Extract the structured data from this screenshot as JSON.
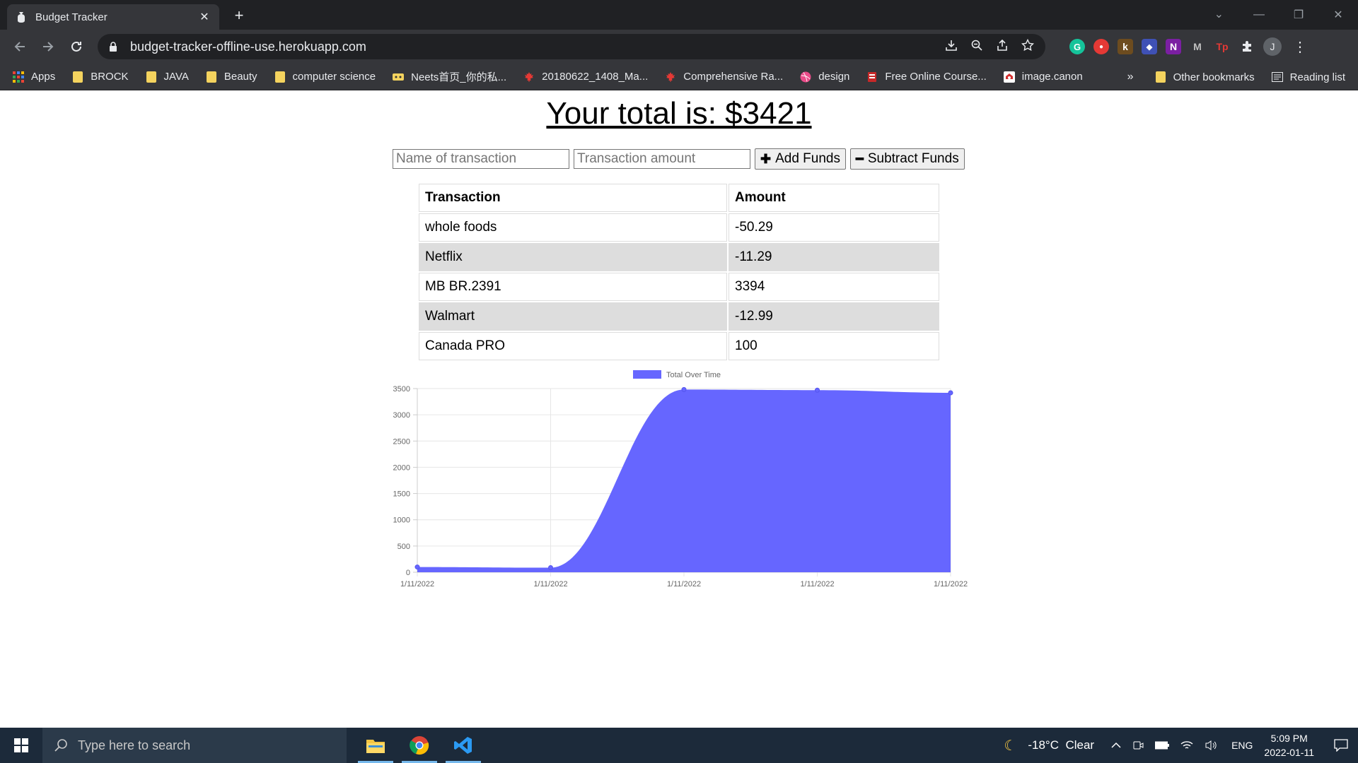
{
  "browser": {
    "tab_title": "Budget Tracker",
    "url": "budget-tracker-offline-use.herokuapp.com",
    "avatar_letter": "J",
    "bookmarks": [
      {
        "label": "Apps",
        "icon": "apps-grid-icon"
      },
      {
        "label": "BROCK",
        "icon": "folder-icon"
      },
      {
        "label": "JAVA",
        "icon": "folder-icon"
      },
      {
        "label": "Beauty",
        "icon": "folder-icon"
      },
      {
        "label": "computer science",
        "icon": "folder-icon"
      },
      {
        "label": "Neets首页_你的私...",
        "icon": "site-icon"
      },
      {
        "label": "20180622_1408_Ma...",
        "icon": "maple-leaf-icon"
      },
      {
        "label": "Comprehensive Ra...",
        "icon": "maple-leaf-icon"
      },
      {
        "label": "design",
        "icon": "dribbble-icon"
      },
      {
        "label": "Free Online Course...",
        "icon": "site-icon"
      },
      {
        "label": "image.canon",
        "icon": "canon-icon"
      }
    ],
    "bookmarks_overflow": "»",
    "other_bookmarks": "Other bookmarks",
    "reading_list": "Reading list",
    "extensions": [
      {
        "label": "G",
        "color": "#15c39a"
      },
      {
        "label": "●",
        "color": "#e53935"
      },
      {
        "label": "k",
        "color": "#5d4037"
      },
      {
        "label": "◆",
        "color": "#3f51b5"
      },
      {
        "label": "N",
        "color": "#7b1fa2"
      },
      {
        "label": "M",
        "color": "#444444"
      },
      {
        "label": "Tp",
        "color": "#e53935"
      }
    ]
  },
  "app": {
    "total_label": "Your total is: $3421",
    "name_placeholder": "Name of transaction",
    "amount_placeholder": "Transaction amount",
    "add_label": "Add Funds",
    "subtract_label": "Subtract Funds",
    "table_headers": [
      "Transaction",
      "Amount"
    ],
    "transactions": [
      {
        "name": "whole foods",
        "amount": "-50.29"
      },
      {
        "name": "Netflix",
        "amount": "-11.29"
      },
      {
        "name": "MB BR.2391",
        "amount": "3394"
      },
      {
        "name": "Walmart",
        "amount": "-12.99"
      },
      {
        "name": "Canada PRO",
        "amount": "100"
      }
    ]
  },
  "chart_data": {
    "type": "area",
    "legend": [
      "Total Over Time"
    ],
    "legend_placement": "top",
    "categories": [
      "1/11/2022",
      "1/11/2022",
      "1/11/2022",
      "1/11/2022",
      "1/11/2022"
    ],
    "series": [
      {
        "name": "Total Over Time",
        "values": [
          100,
          87.01,
          3481.01,
          3469.72,
          3419.43
        ],
        "color": "#6666ff"
      }
    ],
    "yticks": [
      0,
      500,
      1000,
      1500,
      2000,
      2500,
      3000,
      3500
    ],
    "ylim": [
      0,
      3500
    ],
    "grid": true
  },
  "taskbar": {
    "search_placeholder": "Type here to search",
    "weather": "-18°C  Clear",
    "language": "ENG",
    "time": "5:09 PM",
    "date": "2022-01-11"
  }
}
